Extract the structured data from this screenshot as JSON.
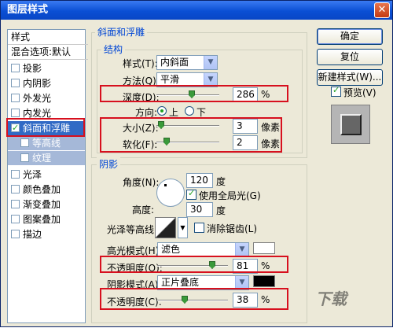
{
  "window": {
    "title": "图层样式"
  },
  "left_list": {
    "header": "样式",
    "blend": "混合选项:默认",
    "items": [
      {
        "label": "投影",
        "checked": false
      },
      {
        "label": "内阴影",
        "checked": false
      },
      {
        "label": "外发光",
        "checked": false
      },
      {
        "label": "内发光",
        "checked": false
      },
      {
        "label": "斜面和浮雕",
        "checked": true
      },
      {
        "label": "等高线",
        "checked": false
      },
      {
        "label": "纹理",
        "checked": false
      },
      {
        "label": "光泽",
        "checked": false
      },
      {
        "label": "颜色叠加",
        "checked": false
      },
      {
        "label": "渐变叠加",
        "checked": false
      },
      {
        "label": "图案叠加",
        "checked": false
      },
      {
        "label": "描边",
        "checked": false
      }
    ]
  },
  "bevel": {
    "group_title": "斜面和浮雕",
    "structure_title": "结构",
    "style_label": "样式(T):",
    "style_value": "内斜面",
    "technique_label": "方法(Q):",
    "technique_value": "平滑",
    "depth_label": "深度(D):",
    "depth_value": "286",
    "depth_unit": "%",
    "depth_level_pct": 57,
    "direction_label": "方向:",
    "dir_up": "上",
    "dir_down": "下",
    "size_label": "大小(Z):",
    "size_value": "3",
    "size_unit": "像素",
    "size_level_pct": 3,
    "soften_label": "软化(F):",
    "soften_value": "2",
    "soften_unit": "像素",
    "soften_level_pct": 12
  },
  "shading": {
    "group_title": "阴影",
    "angle_label": "角度(N):",
    "angle_value": "120",
    "angle_unit": "度",
    "global_light_label": "使用全局光(G)",
    "altitude_label": "高度:",
    "altitude_value": "30",
    "altitude_unit": "度",
    "gloss_label": "光泽等高线:",
    "antialias_label": "消除锯齿(L)",
    "highlight_mode_label": "高光模式(H):",
    "highlight_mode_value": "滤色",
    "highlight_color": "#ffffff",
    "highlight_opacity_label": "不透明度(O):",
    "highlight_opacity_value": "81",
    "highlight_opacity_unit": "%",
    "highlight_opacity_pct": 81,
    "shadow_mode_label": "阴影模式(A):",
    "shadow_mode_value": "正片叠底",
    "shadow_color": "#000000",
    "shadow_opacity_label": "不透明度(C):",
    "shadow_opacity_value": "38",
    "shadow_opacity_unit": "%",
    "shadow_opacity_pct": 38
  },
  "buttons": {
    "ok": "确定",
    "reset": "复位",
    "new_style": "新建样式(W)...",
    "preview_label": "预览(V)"
  },
  "watermark": "下载"
}
